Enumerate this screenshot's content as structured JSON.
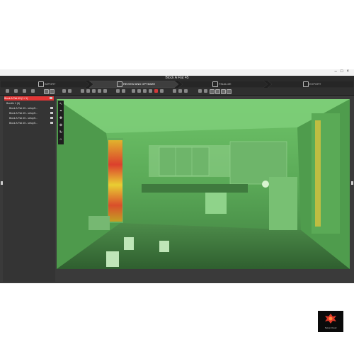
{
  "window": {
    "app_title": "",
    "doc_title": "Block A Flat 45"
  },
  "steps": [
    {
      "label": "IMPORT",
      "icon": "import-icon"
    },
    {
      "label": "REVIEW AND OPTIMIZE",
      "icon": "review-icon",
      "active": true
    },
    {
      "label": "FINALIZE",
      "icon": "finalize-icon"
    },
    {
      "label": "EXPORT",
      "icon": "export-icon"
    }
  ],
  "tree": {
    "items": [
      {
        "label": "Block A Flat 45 (1 / 1)"
      },
      {
        "label": "Bundle 1 (6)"
      },
      {
        "label": "Block A Flat 45 - setupS..."
      },
      {
        "label": "Block A Flat 45 - setupS..."
      },
      {
        "label": "Block A Flat 45 - setupS..."
      },
      {
        "label": "Block A Flat 45 - setupS..."
      }
    ]
  },
  "viewport": {
    "logo_caption": "Setup Cloud"
  },
  "colors": {
    "accent": "#e23636",
    "background": "#3a3a3a",
    "scan_green": "#5fb85a"
  }
}
